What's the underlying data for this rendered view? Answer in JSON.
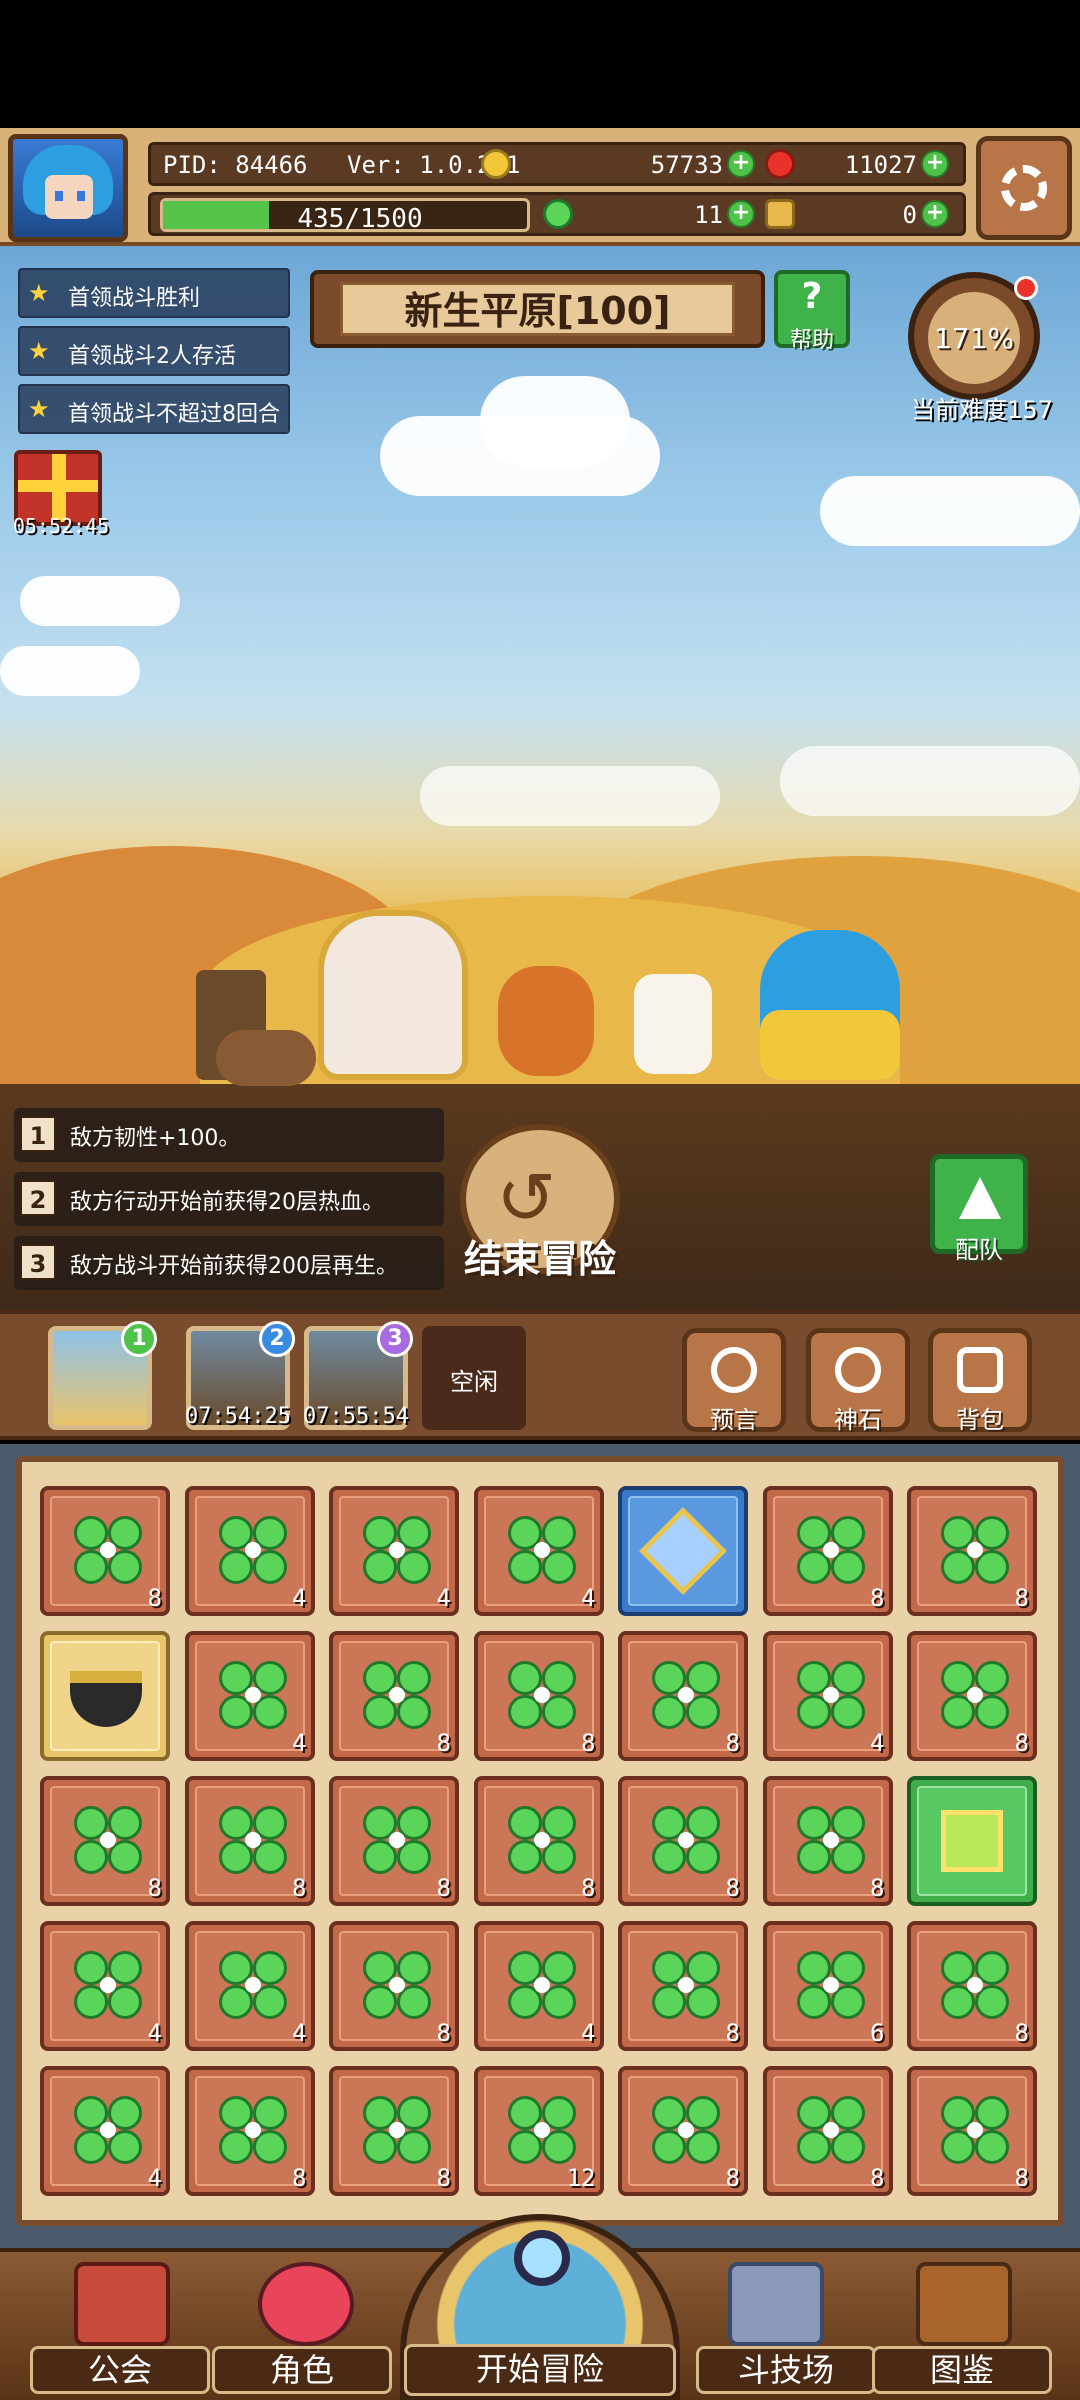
{
  "header": {
    "pid": "PID: 84466",
    "version": "Ver: 1.0.2.1",
    "gold": "57733",
    "gems": "11027",
    "xp": "435/1500",
    "xp_fraction": 0.29,
    "clovers": "11",
    "keys": "0"
  },
  "quests": [
    "首领战斗胜利",
    "首领战斗2人存活",
    "首领战斗不超过8回合"
  ],
  "gift_timer": "05:52:45",
  "area": {
    "name": "新生平原[100]",
    "help_label": "帮助",
    "difficulty_pct": "171%",
    "difficulty_label": "当前难度157"
  },
  "buffs": [
    {
      "num": "1",
      "text": "敌方韧性+100。"
    },
    {
      "num": "2",
      "text": "敌方行动开始前获得20层热血。"
    },
    {
      "num": "3",
      "text": "敌方战斗开始前获得200层再生。"
    }
  ],
  "end_adventure_label": "结束冒险",
  "team_label": "配队",
  "slots": [
    {
      "badge": "1",
      "time": ""
    },
    {
      "badge": "2",
      "time": "07:54:25"
    },
    {
      "badge": "3",
      "time": "07:55:54"
    }
  ],
  "idle_label": "空闲",
  "tools": [
    "预言",
    "神石",
    "背包"
  ],
  "inventory": [
    {
      "type": "clover",
      "qty": "8"
    },
    {
      "type": "clover",
      "qty": "4"
    },
    {
      "type": "clover",
      "qty": "4"
    },
    {
      "type": "clover",
      "qty": "4"
    },
    {
      "type": "blue-gem",
      "qty": ""
    },
    {
      "type": "clover",
      "qty": "8"
    },
    {
      "type": "clover",
      "qty": "8"
    },
    {
      "type": "pot",
      "qty": ""
    },
    {
      "type": "clover",
      "qty": "4"
    },
    {
      "type": "clover",
      "qty": "8"
    },
    {
      "type": "clover",
      "qty": "8"
    },
    {
      "type": "clover",
      "qty": "8"
    },
    {
      "type": "clover",
      "qty": "4"
    },
    {
      "type": "clover",
      "qty": "8"
    },
    {
      "type": "clover",
      "qty": "8"
    },
    {
      "type": "clover",
      "qty": "8"
    },
    {
      "type": "clover",
      "qty": "8"
    },
    {
      "type": "clover",
      "qty": "8"
    },
    {
      "type": "clover",
      "qty": "8"
    },
    {
      "type": "clover",
      "qty": "8"
    },
    {
      "type": "green-gem",
      "qty": ""
    },
    {
      "type": "clover",
      "qty": "4"
    },
    {
      "type": "clover",
      "qty": "4"
    },
    {
      "type": "clover",
      "qty": "8"
    },
    {
      "type": "clover",
      "qty": "4"
    },
    {
      "type": "clover",
      "qty": "8"
    },
    {
      "type": "clover",
      "qty": "6"
    },
    {
      "type": "clover",
      "qty": "8"
    },
    {
      "type": "clover",
      "qty": "4"
    },
    {
      "type": "clover",
      "qty": "8"
    },
    {
      "type": "clover",
      "qty": "8"
    },
    {
      "type": "clover",
      "qty": "12"
    },
    {
      "type": "clover",
      "qty": "8"
    },
    {
      "type": "clover",
      "qty": "8"
    },
    {
      "type": "clover",
      "qty": "8"
    }
  ],
  "nav": {
    "guild": "公会",
    "character": "角色",
    "start_adventure": "开始冒险",
    "arena": "斗技场",
    "codex": "图鉴"
  },
  "colors": {
    "clover": "#5bd45a",
    "panel_brown": "#7a4c2e",
    "accent_green": "#3fb24a",
    "badge1": "#4fc24a",
    "badge2": "#3a8ae0",
    "badge3": "#a86ae0"
  }
}
